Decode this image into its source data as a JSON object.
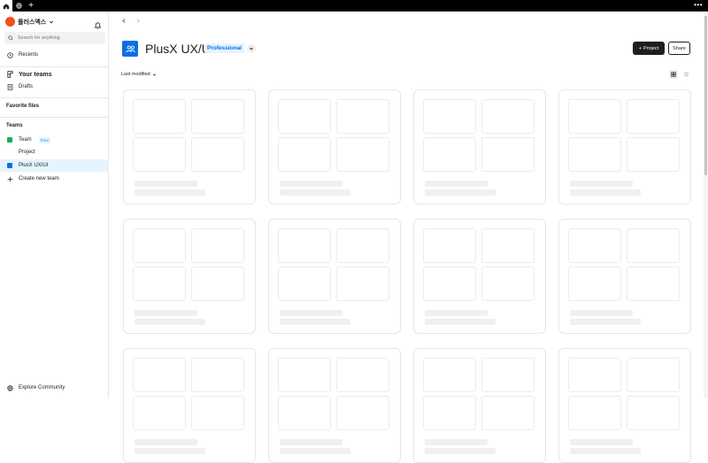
{
  "account": {
    "name": "플러스엑스",
    "avatar_color": "#f24e1e"
  },
  "search": {
    "placeholder": "Search for anything"
  },
  "nav": {
    "recents": "Recents",
    "your_teams": "Your teams",
    "drafts": "Drafts"
  },
  "favorites": {
    "title": "Favorite files"
  },
  "teams": {
    "title": "Teams",
    "items": [
      {
        "label": "Team",
        "badge": "Free",
        "color": "#14ae5c"
      },
      {
        "label": "Project"
      },
      {
        "label": "PlusX UX/UI",
        "color": "#0d6ee6"
      }
    ],
    "create": "Create new team"
  },
  "footer": {
    "explore": "Explore Community"
  },
  "header": {
    "title": "PlusX UX/UI",
    "plan": "Professional",
    "project_button": "Project",
    "share_button": "Share"
  },
  "toolbar": {
    "sort_label": "Last modified"
  },
  "colors": {
    "accent": "#0d6ee6",
    "dark": "#1e1e1e",
    "selected_bg": "#e5f4ff"
  }
}
